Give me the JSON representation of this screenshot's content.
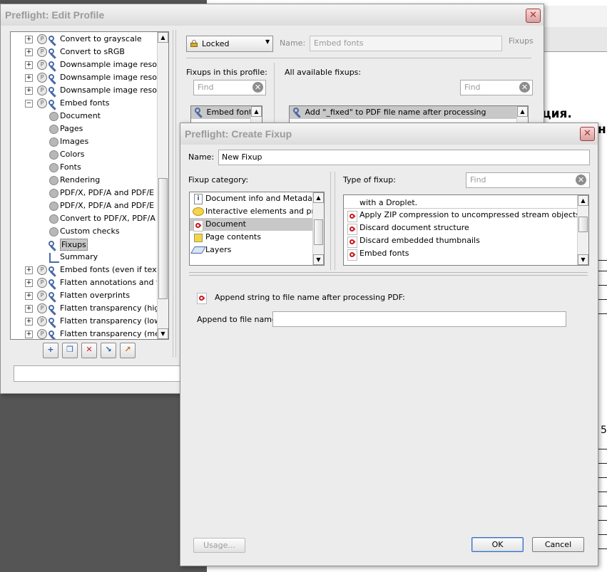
{
  "background_doc": {
    "fragment_1": "ция.",
    "fragment_2": "ни",
    "fragment_3": "5"
  },
  "edit_profile": {
    "title": "Preflight: Edit Profile",
    "lock_select": "Locked",
    "name_label": "Name:",
    "name_value": "Embed fonts",
    "section_label": "Fixups",
    "fixups_in_profile_label": "Fixups in this profile:",
    "all_fixups_label": "All available fixups:",
    "find_placeholder_left": "Find",
    "find_placeholder_right": "Find",
    "profile_fixup_item": "Embed fonts",
    "available_fixup_item": "Add \"_fixed\" to PDF file name after processing",
    "tree": [
      {
        "label": "Convert to grayscale",
        "level": 0
      },
      {
        "label": "Convert to sRGB",
        "level": 0
      },
      {
        "label": "Downsample image resolutio",
        "level": 0
      },
      {
        "label": "Downsample image resolutio",
        "level": 0
      },
      {
        "label": "Downsample image resolutio",
        "level": 0
      },
      {
        "label": "Embed fonts",
        "level": 0
      },
      {
        "label": "Document",
        "level": 1
      },
      {
        "label": "Pages",
        "level": 1
      },
      {
        "label": "Images",
        "level": 1
      },
      {
        "label": "Colors",
        "level": 1
      },
      {
        "label": "Fonts",
        "level": 1
      },
      {
        "label": "Rendering",
        "level": 1
      },
      {
        "label": "PDF/X, PDF/A and PDF/E co",
        "level": 1
      },
      {
        "label": "PDF/X, PDF/A and PDF/E co",
        "level": 1
      },
      {
        "label": "Convert to PDF/X, PDF/A or",
        "level": 1
      },
      {
        "label": "Custom checks",
        "level": 1
      },
      {
        "label": "Fixups",
        "level": 1
      },
      {
        "label": "Summary",
        "level": 1
      },
      {
        "label": "Embed fonts (even if text is",
        "level": 0
      },
      {
        "label": "Flatten annotations and forr",
        "level": 0
      },
      {
        "label": "Flatten overprints",
        "level": 0
      },
      {
        "label": "Flatten transparency (high r",
        "level": 0
      },
      {
        "label": "Flatten transparency (low re",
        "level": 0
      },
      {
        "label": "Flatten transparency (mediu",
        "level": 0
      }
    ],
    "toolbar_icons": [
      "new-icon",
      "duplicate-icon",
      "delete-icon",
      "import-icon",
      "export-icon"
    ]
  },
  "create_fixup": {
    "title": "Preflight: Create Fixup",
    "name_label": "Name:",
    "name_value": "New Fixup",
    "category_label": "Fixup category:",
    "type_label": "Type of fixup:",
    "find_placeholder": "Find",
    "categories": [
      {
        "label": "Document info and Metadata",
        "icon": "info-icon"
      },
      {
        "label": "Interactive elements and prope",
        "icon": "comment-icon"
      },
      {
        "label": "Document",
        "icon": "pdf-icon"
      },
      {
        "label": "Page contents",
        "icon": "page-contents-icon"
      },
      {
        "label": "Layers",
        "icon": "layers-icon"
      }
    ],
    "selected_category": "Document",
    "types_partial_top": "with a Droplet.",
    "types": [
      "Apply ZIP compression to uncompressed stream objects",
      "Discard document structure",
      "Discard embedded thumbnails",
      "Embed fonts"
    ],
    "detail_heading": "Append string to file name after processing PDF:",
    "append_label": "Append to file name:",
    "append_value": "",
    "usage_button": "Usage...",
    "ok_button": "OK",
    "cancel_button": "Cancel"
  }
}
